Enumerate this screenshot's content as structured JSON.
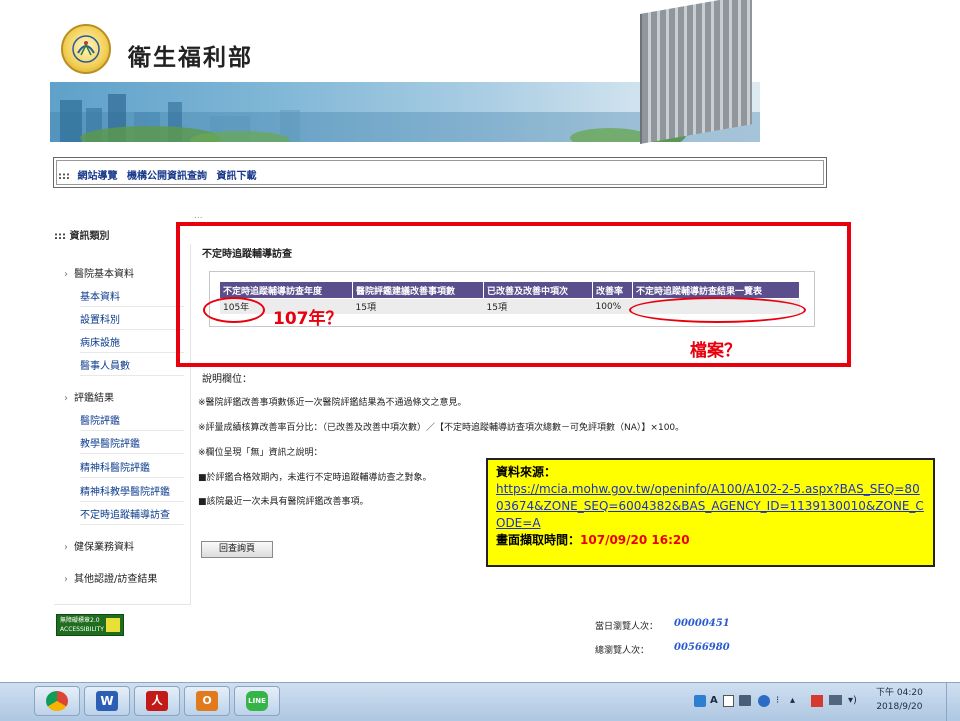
{
  "header": {
    "site_title": "衛生福利部",
    "colors": {
      "red_annotation": "#e8000d",
      "table_header": "#5a4f8c",
      "callout_bg": "#ffff00"
    }
  },
  "breadcrumb": {
    "prefix": ":::",
    "items": [
      "網站導覽",
      "機構公開資訊查詢",
      "資訊下載"
    ]
  },
  "sidebar": {
    "title": "::: 資訊類別",
    "categories": [
      {
        "label": "醫院基本資料",
        "items": [
          "基本資料",
          "設置科別",
          "病床設施",
          "醫事人員數"
        ]
      },
      {
        "label": "評鑑結果",
        "items": [
          "醫院評鑑",
          "教學醫院評鑑",
          "精神科醫院評鑑",
          "精神科教學醫院評鑑",
          "不定時追蹤輔導訪查"
        ]
      },
      {
        "label": "健保業務資料",
        "items": []
      },
      {
        "label": "其他認證/訪查結果",
        "items": []
      }
    ]
  },
  "main": {
    "dots": "...",
    "section_title": "不定時追蹤輔導訪查",
    "table": {
      "headers": [
        "不定時追蹤輔導訪查年度",
        "醫院評鑑建議改善事項數",
        "已改善及改善中項次",
        "改善率",
        "不定時追蹤輔導訪查結果一覽表"
      ],
      "rows": [
        [
          "105年",
          "15項",
          "15項",
          "100%",
          ""
        ]
      ]
    },
    "annotations": {
      "year_question": "107年？",
      "file_question": "檔案？"
    },
    "notes_title": "說明欄位：",
    "notes": [
      "※醫院評鑑改善事項數係近一次醫院評鑑結果為不通過條文之意見。",
      "※評量成績核算改善率百分比：（已改善及改善中項次數）／【不定時追蹤輔導訪查項次總數－可免評項數（NA）】×100。",
      "※欄位呈現「無」資訊之說明：",
      "■於評鑑合格效期內，未進行不定時追蹤輔導訪查之對象。",
      "■該院最近一次未具有醫院評鑑改善事項。"
    ],
    "back_button": "回查詢頁"
  },
  "callout": {
    "source_label": "資料來源：",
    "url": "https://mcia.mohw.gov.tw/openinfo/A100/A102-2-5.aspx?BAS_SEQ=8003674&ZONE_SEQ=6004382&BAS_AGENCY_ID=1139130010&ZONE_CODE=A",
    "time_label": "畫面擷取時間：",
    "time_value": "107/09/20  16:20"
  },
  "footer": {
    "badge": "無障礙標章2.0",
    "badge_sub": "ACCESSIBILITY",
    "counters": [
      {
        "label": "當日瀏覽人次：",
        "value": "00000451"
      },
      {
        "label": "總瀏覽人次：",
        "value": "00566980"
      }
    ]
  },
  "taskbar": {
    "apps": [
      {
        "icon": "chrome-icon",
        "color": "#4aa14a"
      },
      {
        "icon": "word-icon",
        "color": "#2b5fb4"
      },
      {
        "icon": "pdf-icon",
        "color": "#c21b17"
      },
      {
        "icon": "outlook-icon",
        "color": "#e07a1c"
      },
      {
        "icon": "line-icon",
        "color": "#35b547"
      }
    ],
    "ime": "A",
    "clock_time": "下午 04:20",
    "clock_date": "2018/9/20"
  }
}
